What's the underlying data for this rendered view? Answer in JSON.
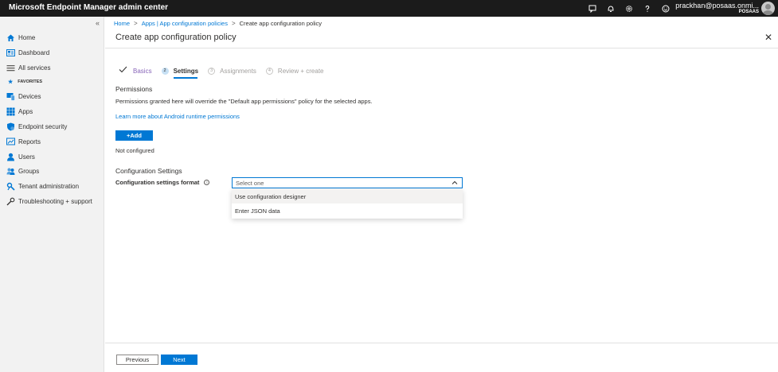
{
  "topbar": {
    "title": "Microsoft Endpoint Manager admin center",
    "icons": [
      "feedback-icon",
      "bell-icon",
      "gear-icon",
      "help-icon",
      "smiley-icon"
    ],
    "user_email": "prackhan@posaas.onmi...",
    "user_org": "POSAAS"
  },
  "sidebar": {
    "collapse": "«",
    "items": [
      {
        "label": "Home",
        "icon": "home-icon"
      },
      {
        "label": "Dashboard",
        "icon": "dashboard-icon"
      },
      {
        "label": "All services",
        "icon": "list-icon"
      },
      {
        "label": "FAVORITES",
        "icon": "star-icon"
      },
      {
        "label": "Devices",
        "icon": "devices-icon"
      },
      {
        "label": "Apps",
        "icon": "apps-icon"
      },
      {
        "label": "Endpoint security",
        "icon": "shield-icon"
      },
      {
        "label": "Reports",
        "icon": "reports-icon"
      },
      {
        "label": "Users",
        "icon": "user-icon"
      },
      {
        "label": "Groups",
        "icon": "groups-icon"
      },
      {
        "label": "Tenant administration",
        "icon": "tenant-icon"
      },
      {
        "label": "Troubleshooting + support",
        "icon": "wrench-icon"
      }
    ]
  },
  "breadcrumb": {
    "home": "Home",
    "apps": "Apps | App configuration policies",
    "current": "Create app configuration policy",
    "separator": ">"
  },
  "page": {
    "title": "Create app configuration policy",
    "close": "✕"
  },
  "steps": [
    {
      "label": "Basics",
      "state": "done"
    },
    {
      "label": "Settings",
      "num": "2",
      "state": "active"
    },
    {
      "label": "Assignments",
      "num": "3",
      "state": "inactive"
    },
    {
      "label": "Review + create",
      "num": "4",
      "state": "inactive"
    }
  ],
  "permissions": {
    "title": "Permissions",
    "description": "Permissions granted here will override the \"Default app permissions\" policy for the selected apps.",
    "link": "Learn more about Android runtime permissions",
    "add_button": "+Add",
    "status": "Not configured"
  },
  "config": {
    "title": "Configuration Settings",
    "format_label": "Configuration settings format",
    "info": "i",
    "select_placeholder": "Select one",
    "options": [
      "Use configuration designer",
      "Enter JSON data"
    ]
  },
  "footer": {
    "previous": "Previous",
    "next": "Next"
  },
  "colors": {
    "accent": "#0078d4",
    "topbar": "#1b1b1b",
    "sidebar": "#f2f2f2",
    "done_step": "#8764b8"
  }
}
